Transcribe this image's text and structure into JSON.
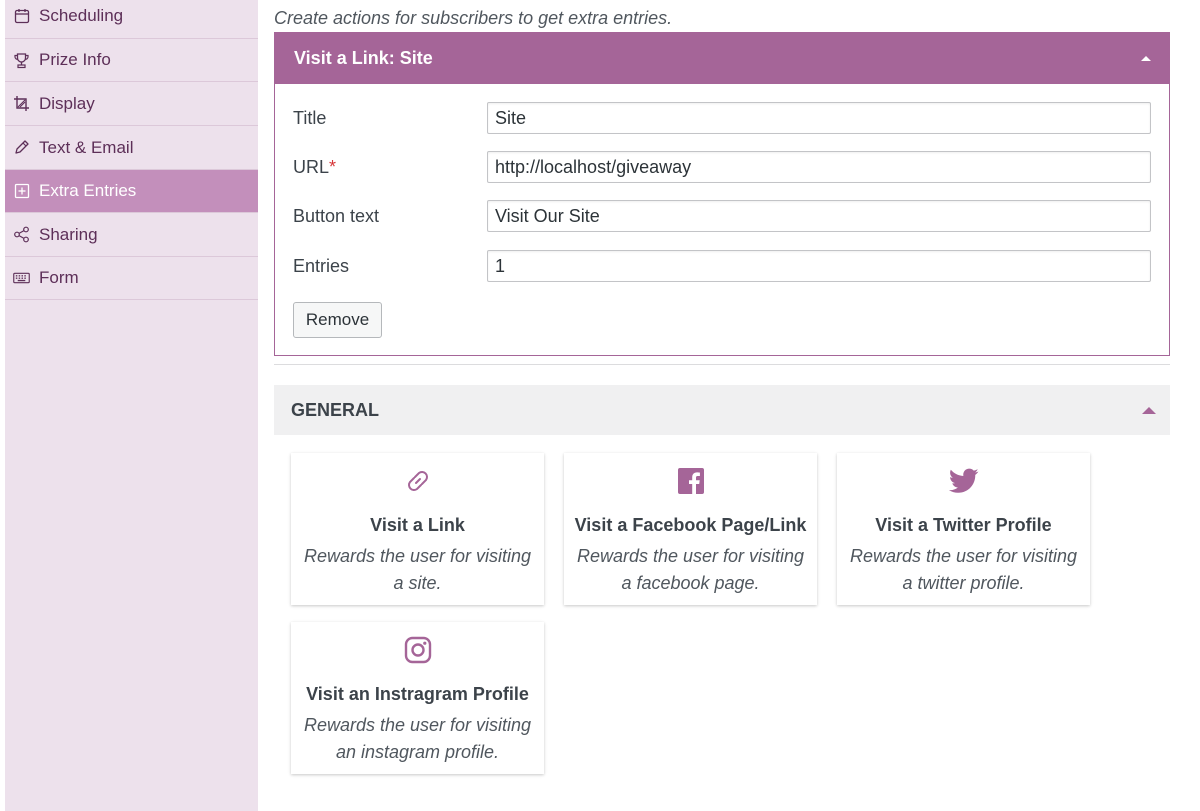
{
  "sidebar": {
    "items": [
      {
        "label": "Scheduling",
        "icon": "calendar-icon",
        "active": false
      },
      {
        "label": "Prize Info",
        "icon": "trophy-icon",
        "active": false
      },
      {
        "label": "Display",
        "icon": "crop-icon",
        "active": false
      },
      {
        "label": "Text & Email",
        "icon": "pencil-icon",
        "active": false
      },
      {
        "label": "Extra Entries",
        "icon": "plus-square-icon",
        "active": true
      },
      {
        "label": "Sharing",
        "icon": "share-icon",
        "active": false
      },
      {
        "label": "Form",
        "icon": "keyboard-icon",
        "active": false
      }
    ]
  },
  "main": {
    "intro": "Create actions for subscribers to get extra entries.",
    "panel": {
      "title": "Visit a Link: Site",
      "fields": {
        "title": {
          "label": "Title",
          "value": "Site"
        },
        "url": {
          "label": "URL",
          "required_mark": "*",
          "value": "http://localhost/giveaway"
        },
        "button_text": {
          "label": "Button text",
          "value": "Visit Our Site"
        },
        "entries": {
          "label": "Entries",
          "value": "1"
        }
      },
      "remove_label": "Remove"
    },
    "general": {
      "heading": "GENERAL",
      "cards": [
        {
          "icon": "link-icon",
          "title": "Visit a Link",
          "desc_line1": "Rewards the user for visiting",
          "desc_line2": "a site."
        },
        {
          "icon": "facebook-icon",
          "title": "Visit a Facebook Page/Link",
          "desc_line1": "Rewards the user for visiting",
          "desc_line2": "a facebook page."
        },
        {
          "icon": "twitter-icon",
          "title": "Visit a Twitter Profile",
          "desc_line1": "Rewards the user for visiting",
          "desc_line2": "a twitter profile."
        },
        {
          "icon": "instagram-icon",
          "title": "Visit an Instragram Profile",
          "desc_line1": "Rewards the user for visiting",
          "desc_line2": "an instagram profile."
        }
      ]
    }
  },
  "colors": {
    "accent": "#a56598",
    "sidebar_bg": "#ede1ec",
    "sidebar_active": "#c38fbb",
    "required": "#d63638"
  }
}
